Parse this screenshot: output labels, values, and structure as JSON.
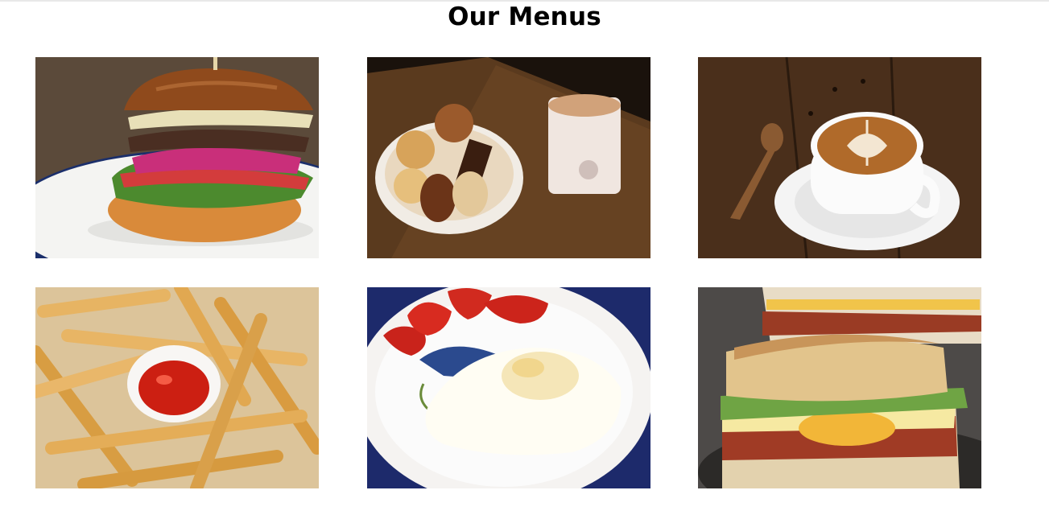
{
  "page": {
    "title": "Our Menus"
  },
  "menu_items": [
    {
      "image": "burger-photo"
    },
    {
      "image": "cookies-and-tea-photo"
    },
    {
      "image": "latte-coffee-photo"
    },
    {
      "image": "french-fries-with-ketchup-photo"
    },
    {
      "image": "fried-egg-with-tomatoes-photo"
    },
    {
      "image": "egg-bacon-sandwich-photo"
    }
  ]
}
